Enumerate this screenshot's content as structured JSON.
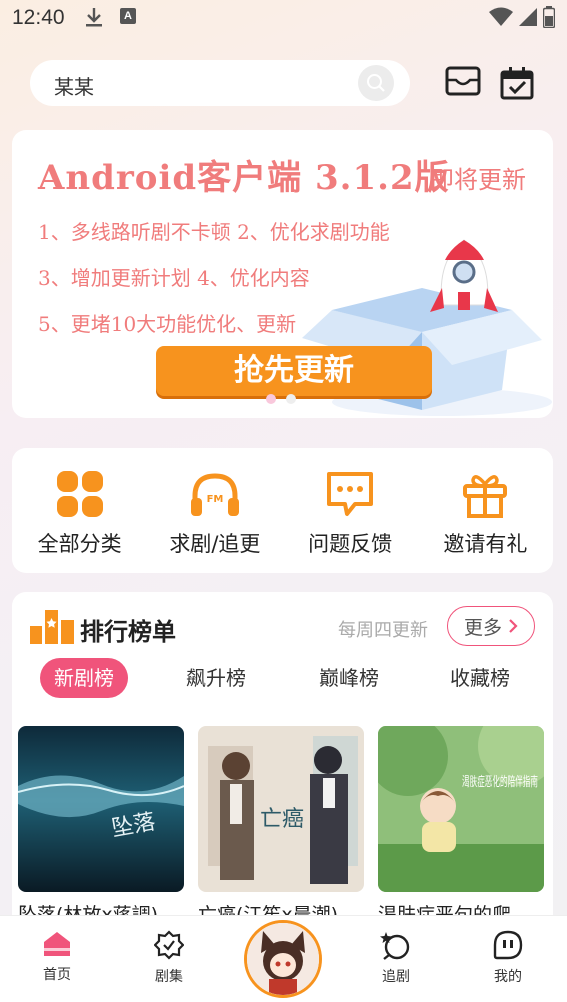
{
  "status_bar": {
    "time": "12:40",
    "a_badge": "A"
  },
  "search": {
    "value": "某某"
  },
  "banner": {
    "title": "Android客户端 3.1.2版",
    "subtitle": "即将更新",
    "lines": [
      "1、多线路听剧不卡顿 2、优化求剧功能",
      "3、增加更新计划 4、优化内容",
      "5、更堵10大功能优化、更新"
    ],
    "button": "抢先更新"
  },
  "quick_actions": [
    {
      "label": "全部分类",
      "icon": "grid-icon"
    },
    {
      "label": "求剧/追更",
      "icon": "headphones-icon"
    },
    {
      "label": "问题反馈",
      "icon": "chat-bubble-icon"
    },
    {
      "label": "邀请有礼",
      "icon": "gift-icon"
    }
  ],
  "ranking": {
    "title": "排行榜单",
    "note": "每周四更新",
    "more": "更多",
    "tabs": [
      "新剧榜",
      "飙升榜",
      "巅峰榜",
      "收藏榜"
    ],
    "active_tab": "新剧榜",
    "cards": [
      {
        "title": "坠落(林放x蒋調)",
        "cover_text": "坠落"
      },
      {
        "title": "亡癌(江笙x晨潮)",
        "cover_text": "亡癌"
      },
      {
        "title": "渴肤症恶句的爬",
        "cover_text": "渴肤症恶化的陪伴指南"
      }
    ]
  },
  "bottom_nav": [
    {
      "label": "首页",
      "icon": "home-icon",
      "active": true
    },
    {
      "label": "剧集",
      "icon": "badge-icon"
    },
    {
      "label": "追剧",
      "icon": "chase-icon"
    },
    {
      "label": "我的",
      "icon": "profile-icon"
    }
  ],
  "colors": {
    "accent": "#f0547b",
    "orange": "#f7931e",
    "banner_text": "#f07c7c"
  }
}
